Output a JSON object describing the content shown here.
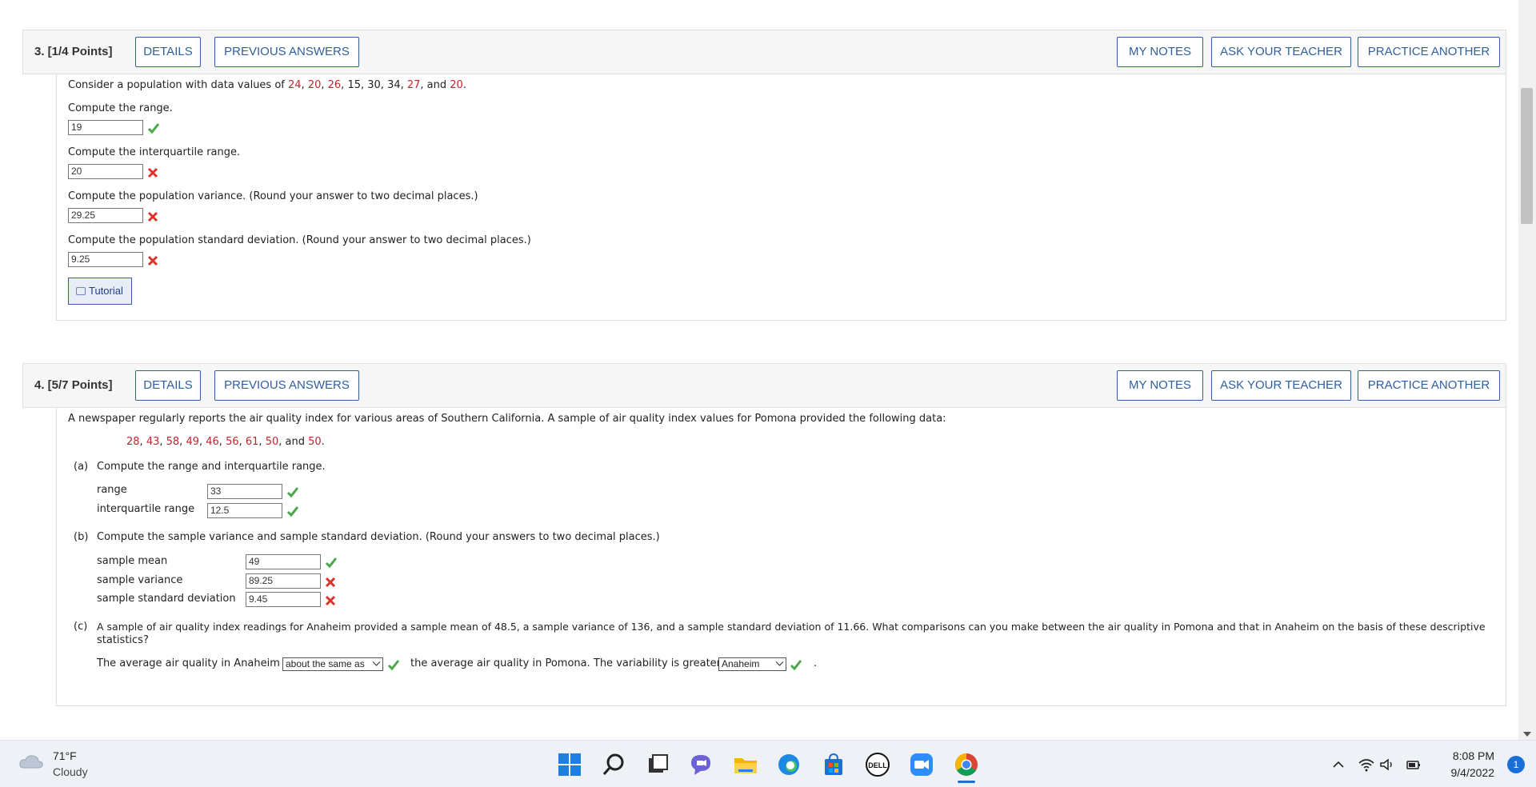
{
  "q3": {
    "title": "3. [1/4 Points]",
    "buttons": {
      "details": "DETAILS",
      "previous": "PREVIOUS ANSWERS",
      "notes": "MY NOTES",
      "ask": "ASK YOUR TEACHER",
      "practice": "PRACTICE ANOTHER"
    },
    "intro_prefix": "Consider a population with data values of ",
    "data_values": [
      "24",
      "20",
      "26",
      "15",
      "30",
      "34",
      "27",
      "20"
    ],
    "data_red": [
      true,
      true,
      true,
      false,
      false,
      false,
      true,
      true
    ],
    "range_label": "Compute the range.",
    "range_value": "19",
    "iqr_label": "Compute the interquartile range.",
    "iqr_value": "20",
    "variance_label": "Compute the population variance. (Round your answer to two decimal places.)",
    "variance_value": "29.25",
    "std_label": "Compute the population standard deviation. (Round your answer to two decimal places.)",
    "std_value": "9.25",
    "tutorial_label": "Tutorial"
  },
  "q4": {
    "title": "4. [5/7 Points]",
    "buttons": {
      "details": "DETAILS",
      "previous": "PREVIOUS ANSWERS",
      "notes": "MY NOTES",
      "ask": "ASK YOUR TEACHER",
      "practice": "PRACTICE ANOTHER"
    },
    "intro": "A newspaper regularly reports the air quality index for various areas of Southern California. A sample of air quality index values for Pomona provided the following data:",
    "data_values": [
      "28",
      "43",
      "58",
      "49",
      "46",
      "56",
      "61",
      "50",
      "50"
    ],
    "part_a": {
      "label": "(a)",
      "text": "Compute the range and interquartile range.",
      "range_label": "range",
      "range_value": "33",
      "iqr_label": "interquartile range",
      "iqr_value": "12.5"
    },
    "part_b": {
      "label": "(b)",
      "text": "Compute the sample variance and sample standard deviation. (Round your answers to two decimal places.)",
      "mean_label": "sample mean",
      "mean_value": "49",
      "variance_label": "sample variance",
      "variance_value": "89.25",
      "std_label": "sample standard deviation",
      "std_value": "9.45"
    },
    "part_c": {
      "label": "(c)",
      "text_line1": "A sample of air quality index readings for Anaheim provided a sample mean of 48.5, a sample variance of 136, and a sample standard deviation of 11.66. What comparisons can you make between the air quality in Pomona and that in Anaheim on the basis of these descriptive",
      "text_line2": "statistics?",
      "sentence_start": "The average air quality in Anaheim is",
      "select1_value": "about the same as",
      "sentence_mid": "the average air quality in Pomona. The variability is greater in",
      "select2_value": "Anaheim",
      "sentence_end": "."
    }
  },
  "taskbar": {
    "temperature": "71°F",
    "condition": "Cloudy",
    "icons": [
      "windows-start-icon",
      "search-icon",
      "task-view-icon",
      "chat-icon",
      "file-explorer-icon",
      "edge-icon",
      "store-icon",
      "dell-icon",
      "zoom-icon",
      "chrome-icon"
    ],
    "time": "8:08 PM",
    "date": "9/4/2022",
    "notification_count": "1"
  },
  "colors": {
    "accent": "#2f5f9f",
    "correct": "#4aa84a",
    "incorrect": "#d9342b",
    "data_red": "#c0252c"
  }
}
